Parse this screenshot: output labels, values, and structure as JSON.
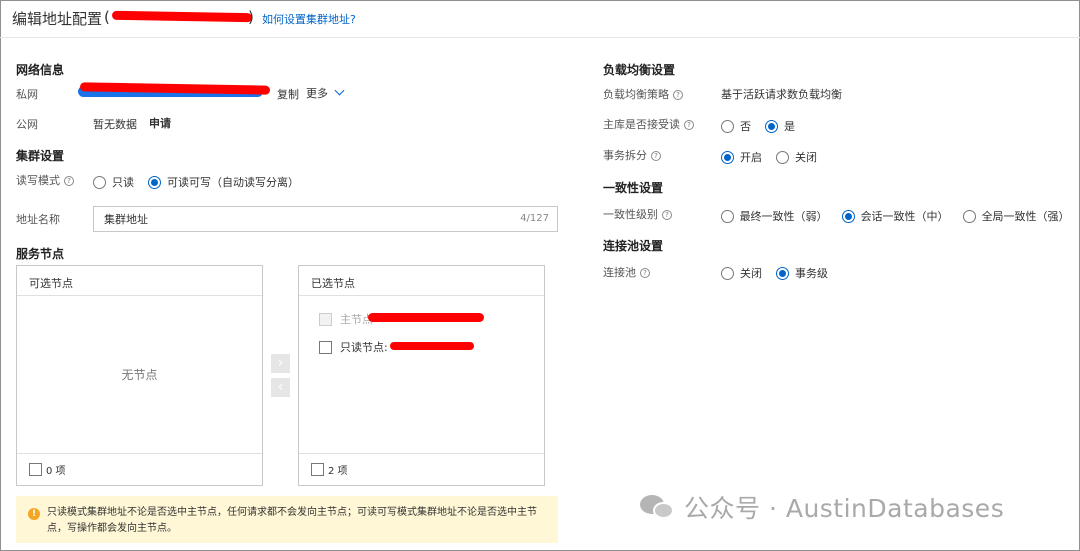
{
  "header": {
    "title": "编辑地址配置",
    "paren_open": "(",
    "paren_close": ")",
    "help_link": "如何设置集群地址?"
  },
  "network": {
    "section_title": "网络信息",
    "private_label": "私网",
    "copy_link": "复制",
    "more_link": "更多",
    "public_label": "公网",
    "public_value": "暂无数据",
    "apply_link": "申请"
  },
  "cluster": {
    "section_title": "集群设置",
    "rw_mode_label": "读写模式",
    "rw_options": [
      {
        "label": "只读",
        "selected": false
      },
      {
        "label": "可读可写（自动读写分离）",
        "selected": true
      }
    ],
    "address_name_label": "地址名称",
    "address_name_value": "集群地址",
    "address_name_count": "4/127"
  },
  "service_nodes": {
    "section_title": "服务节点",
    "available_title": "可选节点",
    "available_empty": "无节点",
    "available_footer": "0 项",
    "selected_title": "已选节点",
    "selected_items": [
      {
        "label": "主节点",
        "disabled": true
      },
      {
        "label": "只读节点: ",
        "disabled": false
      }
    ],
    "selected_footer": "2 项",
    "move_right": "›",
    "move_left": "‹"
  },
  "notice": {
    "text": "只读模式集群地址不论是否选中主节点，任何请求都不会发向主节点；可读可写模式集群地址不论是否选中主节点，写操作都会发向主节点。",
    "icon": "warning-icon"
  },
  "load_balance": {
    "section_title": "负载均衡设置",
    "strategy_label": "负载均衡策略",
    "strategy_value": "基于活跃请求数负载均衡",
    "primary_read_label": "主库是否接受读",
    "primary_read_options": [
      {
        "label": "否",
        "selected": false
      },
      {
        "label": "是",
        "selected": true
      }
    ],
    "txn_split_label": "事务拆分",
    "txn_split_options": [
      {
        "label": "开启",
        "selected": true
      },
      {
        "label": "关闭",
        "selected": false
      }
    ]
  },
  "consistency": {
    "section_title": "一致性设置",
    "level_label": "一致性级别",
    "level_options": [
      {
        "label": "最终一致性（弱）",
        "selected": false
      },
      {
        "label": "会话一致性（中）",
        "selected": true
      },
      {
        "label": "全局一致性（强）",
        "selected": false
      }
    ]
  },
  "pool": {
    "section_title": "连接池设置",
    "pool_label": "连接池",
    "pool_options": [
      {
        "label": "关闭",
        "selected": false
      },
      {
        "label": "事务级",
        "selected": true
      }
    ]
  },
  "watermark": {
    "text": "公众号 · AustinDatabases"
  },
  "colors": {
    "link": "#0064c8",
    "notice_bg": "#fff7d6",
    "warning": "#f5a623",
    "redaction": "#ff0000"
  }
}
